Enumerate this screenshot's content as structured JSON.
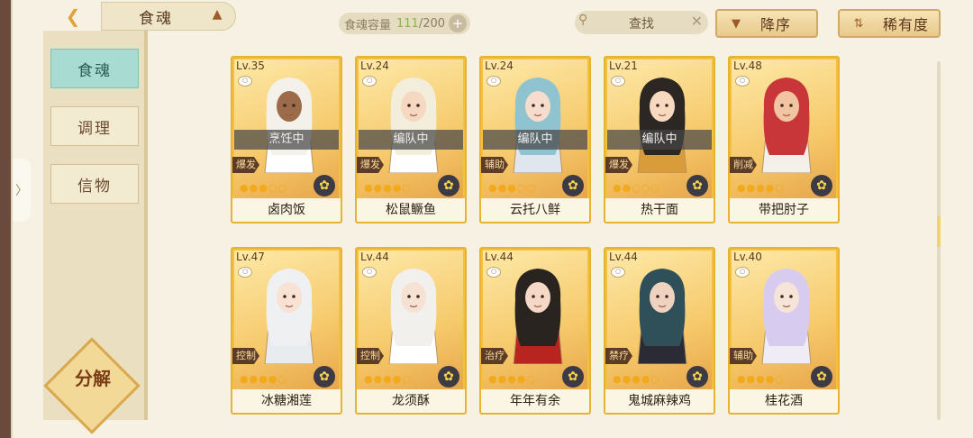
{
  "header": {
    "back_icon": "back-chevron-icon",
    "title": "食魂",
    "title_icon": "hat-icon",
    "capacity_label": "食魂容量",
    "capacity_used": "111",
    "capacity_total": "/200",
    "capacity_add": "+",
    "search_placeholder": "查找",
    "search_clear": "✕",
    "sort_desc_label": "降序",
    "sort_rarity_label": "稀有度"
  },
  "sidebar": {
    "tabs": [
      {
        "label": "食魂",
        "active": true
      },
      {
        "label": "调理",
        "active": false
      },
      {
        "label": "信物",
        "active": false
      }
    ],
    "decompose_label": "分解",
    "handle_glyph": "〉"
  },
  "cards": [
    {
      "level": "Lv.35",
      "status": "烹饪中",
      "role": "爆发",
      "name": "卤肉饭",
      "stars_filled": 3,
      "stars_total": 5,
      "hair": "#f4f0ea",
      "skin": "#9c6b4a",
      "cloth": "#ffffff"
    },
    {
      "level": "Lv.24",
      "status": "编队中",
      "role": "爆发",
      "name": "松鼠鳜鱼",
      "stars_filled": 4,
      "stars_total": 5,
      "hair": "#f3eedc",
      "skin": "#f6d8c0",
      "cloth": "#ffffff"
    },
    {
      "level": "Lv.24",
      "status": "编队中",
      "role": "辅助",
      "name": "云托八鲜",
      "stars_filled": 3,
      "stars_total": 5,
      "hair": "#8fc3cf",
      "skin": "#f6dccd",
      "cloth": "#dfe6ee"
    },
    {
      "level": "Lv.21",
      "status": "编队中",
      "role": "爆发",
      "name": "热干面",
      "stars_filled": 2,
      "stars_total": 5,
      "hair": "#2d2723",
      "skin": "#f7d9c0",
      "cloth": "#d89c3a"
    },
    {
      "level": "Lv.48",
      "status": "",
      "role": "削减",
      "name": "带把肘子",
      "stars_filled": 4,
      "stars_total": 5,
      "hair": "#c8363a",
      "skin": "#f3c4a2",
      "cloth": "#f4efe8"
    },
    {
      "level": "Lv.47",
      "status": "",
      "role": "控制",
      "name": "冰糖湘莲",
      "stars_filled": 4,
      "stars_total": 5,
      "hair": "#eef0f2",
      "skin": "#f7e2d4",
      "cloth": "#e9ecef"
    },
    {
      "level": "Lv.44",
      "status": "",
      "role": "控制",
      "name": "龙须酥",
      "stars_filled": 4,
      "stars_total": 5,
      "hair": "#f2f0ed",
      "skin": "#f6e2d3",
      "cloth": "#ffffff"
    },
    {
      "level": "Lv.44",
      "status": "",
      "role": "治疗",
      "name": "年年有余",
      "stars_filled": 4,
      "stars_total": 5,
      "hair": "#2a2420",
      "skin": "#f5d8c5",
      "cloth": "#b8241f"
    },
    {
      "level": "Lv.44",
      "status": "",
      "role": "禁疗",
      "name": "鬼城麻辣鸡",
      "stars_filled": 4,
      "stars_total": 5,
      "hair": "#2f4f59",
      "skin": "#f0d2c0",
      "cloth": "#2b2b35"
    },
    {
      "level": "Lv.40",
      "status": "",
      "role": "辅助",
      "name": "桂花酒",
      "stars_filled": 4,
      "stars_total": 5,
      "hair": "#d7ccef",
      "skin": "#f7e4d8",
      "cloth": "#f0ecf6"
    }
  ],
  "icons": {
    "pin": "pin-icon",
    "flower": "osmanthus-icon",
    "search": "search-icon",
    "sort": "sort-arrow-icon",
    "rarity": "rarity-icon"
  },
  "colors": {
    "accent_gold": "#f3c13e",
    "active_tab": "#a8dcd3",
    "panel_bg": "#f6f1e2"
  }
}
